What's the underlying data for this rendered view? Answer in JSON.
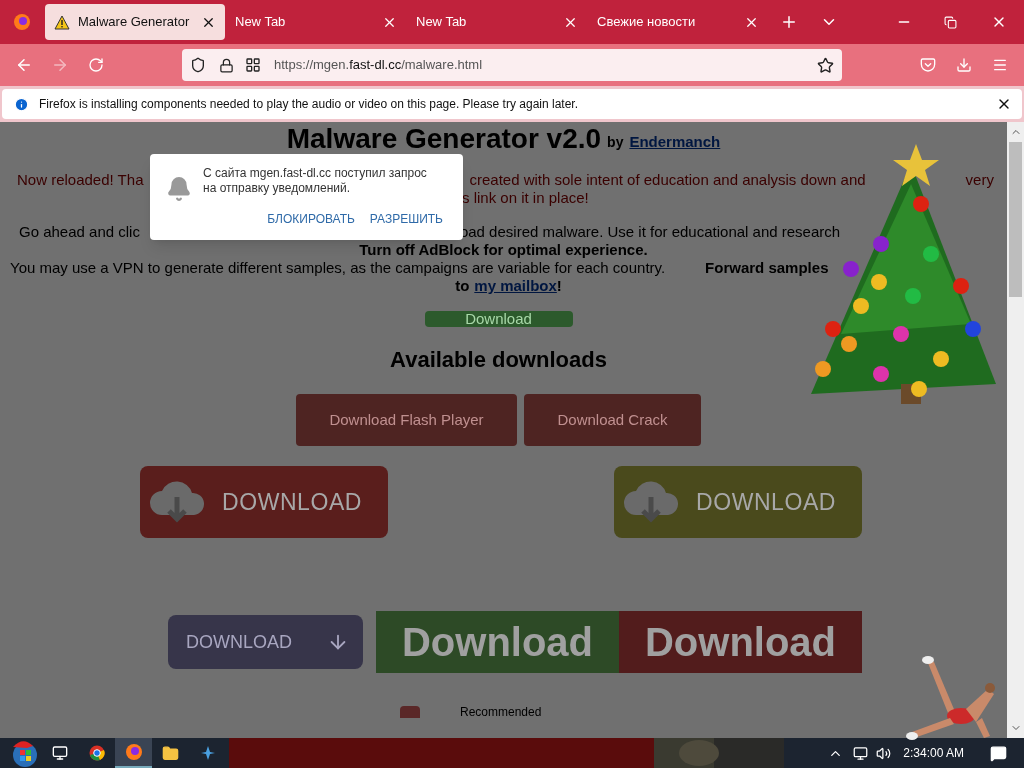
{
  "tabs": [
    {
      "title": "Malware Generator",
      "selected": true,
      "warning": true
    },
    {
      "title": "New Tab",
      "selected": false,
      "warning": false
    },
    {
      "title": "New Tab",
      "selected": false,
      "warning": false
    },
    {
      "title": "Свежие новости",
      "selected": false,
      "warning": false
    }
  ],
  "address_bar": {
    "url_prefix": "https://mgen.",
    "url_domain": "fast-dl.cc",
    "url_path": "/malware.html"
  },
  "info_bar": {
    "message": "Firefox is installing components needed to play the audio or video on this page. Please try again later."
  },
  "page": {
    "title": "Malware Generator v2.0",
    "by": "by",
    "author_link": "Endermanch",
    "intro_left": "Now reloaded! Tha",
    "intro_middle": "created with sole intent of education and analysis down and",
    "intro_right": "very",
    "intro_line2": "s link on it in place!",
    "go_left": "Go ahead and clic",
    "go_right": "oad desired malware. Use it for educational and research",
    "adblock": "Turn off AdBlock for optimal experience.",
    "vpn_text": "You may use a VPN to generate different samples, as the campaigns are variable for each country.",
    "forward": "Forward samples",
    "to": "to",
    "mailbox_link": "my mailbox",
    "bang": "!",
    "small_download": "Download",
    "available": "Available downloads",
    "buttons_row": [
      "Download Flash Player",
      "Download Crack"
    ],
    "cloud_buttons": [
      {
        "label": "DOWNLOAD",
        "color": "#5a1e1c"
      },
      {
        "label": "DOWNLOAD",
        "color": "#4a4a1c"
      }
    ],
    "arrow_button": "DOWNLOAD",
    "big_buttons": [
      {
        "label": "Download",
        "color": "#2d4a26"
      },
      {
        "label": "Download",
        "color": "#521c1c"
      }
    ],
    "recommended": "Recommended"
  },
  "notification_popup": {
    "message": "С сайта mgen.fast-dl.cc поступил запрос на отправку уведомлений.",
    "actions": [
      "БЛОКИРОВАТЬ",
      "РАЗРЕШИТЬ"
    ]
  },
  "taskbar": {
    "apps": [
      {
        "kind": "taskview",
        "selected": false
      },
      {
        "kind": "chrome",
        "selected": false
      },
      {
        "kind": "firefox",
        "selected": true
      },
      {
        "kind": "explorer",
        "selected": false
      },
      {
        "kind": "tool",
        "selected": false
      }
    ],
    "time": "2:34:00 AM"
  }
}
